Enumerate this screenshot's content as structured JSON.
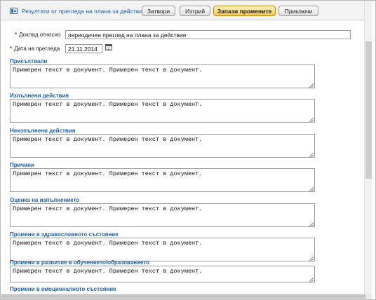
{
  "toolbar": {
    "title": "Резултати от прегледа на плана за действие",
    "buttons": {
      "close": "Затвори",
      "delete": "Изтрий",
      "save": "Запази промените",
      "finish": "Приключи"
    }
  },
  "form": {
    "report_label": "Доклад относно",
    "report_value": "периодичен преглед на плана за действие",
    "date_label": "Дата на прегледа",
    "date_value": "21.11.2014",
    "sections": [
      {
        "label": "Присъствали",
        "value": "Примерен текст в документ. Примерен текст в документ."
      },
      {
        "label": "Изпълнени действия",
        "value": "Примерен текст в документ. Примерен текст в документ."
      },
      {
        "label": "Неизпълнени действия",
        "value": "Примерен текст в документ. Примерен текст в документ."
      },
      {
        "label": "Причини",
        "value": "Примерен текст в документ. Примерен текст в документ."
      },
      {
        "label": "Оценка на изпълнението",
        "value": "Примерен текст в документ. Примерен текст в документ."
      },
      {
        "label": "Промени в здравословното състояние",
        "value": "Примерен текст в документ. Примерен текст в документ."
      },
      {
        "label": "Промени в развитие в обучението/образованието",
        "value": "Примерен текст в документ. Примерен текст в документ."
      },
      {
        "label": "Промени в емоционалното състояние"
      }
    ]
  },
  "icons": {
    "document": "document-icon",
    "calendar": "calendar-icon",
    "required": "required-asterisk"
  },
  "colors": {
    "accent": "#1f5fa8",
    "required": "#cc2200",
    "save_button": "#f7c948"
  }
}
